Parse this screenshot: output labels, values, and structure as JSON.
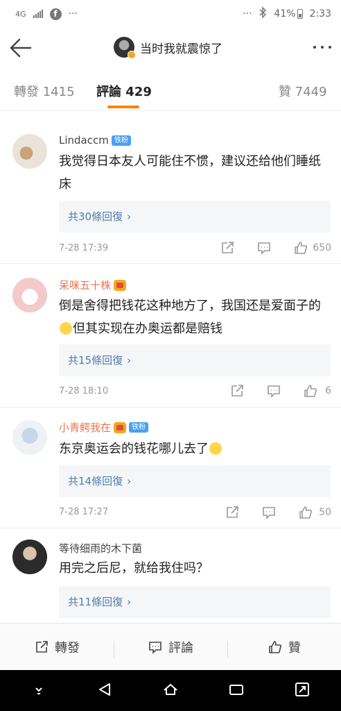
{
  "statusbar": {
    "network": "4G",
    "ellipsis_left": "···",
    "ellipsis_right": "···",
    "battery": "41%",
    "time": "2:33"
  },
  "header": {
    "title": "当时我就震惊了"
  },
  "tabs": [
    {
      "label": "轉發 1415"
    },
    {
      "label": "評論 429"
    },
    {
      "label": "贊 7449"
    }
  ],
  "accent_color": "#ff8200",
  "comments": [
    {
      "username": "Lindaccm",
      "badge": "铁粉",
      "text": "我觉得日本友人可能住不惯，建议还给他们睡纸床",
      "replies": "共30條回復",
      "time": "7-28 17:39",
      "likes": "650"
    },
    {
      "username": "呆咪五十株",
      "text_a": "倒是舍得把钱花这种地方了，我国还是爱面子的",
      "text_b": "但其实现在办奥运都是赔钱",
      "replies": "共15條回復",
      "time": "7-28 18:10",
      "likes": "6"
    },
    {
      "username": "小青鳄我在",
      "badge": "铁粉",
      "text": "东京奥运会的钱花哪儿去了",
      "replies": "共14條回復",
      "time": "7-28 17:27",
      "likes": "50"
    },
    {
      "username": "等待细雨的木下菌",
      "text": "用完之后尼，就给我住吗？",
      "replies": "共11條回復"
    }
  ],
  "bottombar": {
    "repost": "轉發",
    "comment": "評論",
    "like": "贊"
  }
}
